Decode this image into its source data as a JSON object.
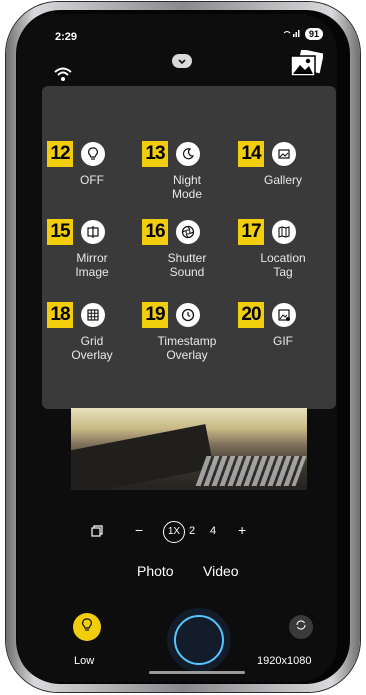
{
  "status": {
    "time": "2:29",
    "battery": "91",
    "signal_icons": "wifi-signal-icons"
  },
  "top": {
    "wifi_icon": "wifi-icon",
    "collapse_icon": "chevron-down-icon",
    "gallery_icon": "gallery-images-icon"
  },
  "panel": {
    "items": [
      {
        "num": "12",
        "icon": "bulb-icon",
        "label": "OFF"
      },
      {
        "num": "13",
        "icon": "moon-icon",
        "label": "Night\nMode"
      },
      {
        "num": "14",
        "icon": "image-icon",
        "label": "Gallery"
      },
      {
        "num": "15",
        "icon": "mirror-icon",
        "label": "Mirror\nImage"
      },
      {
        "num": "16",
        "icon": "shutter-aperture-icon",
        "label": "Shutter\nSound"
      },
      {
        "num": "17",
        "icon": "map-icon",
        "label": "Location\nTag"
      },
      {
        "num": "18",
        "icon": "grid-icon",
        "label": "Grid\nOverlay"
      },
      {
        "num": "19",
        "icon": "clock-icon",
        "label": "Timestamp\nOverlay"
      },
      {
        "num": "20",
        "icon": "gif-image-icon",
        "label": "GIF"
      }
    ]
  },
  "zoom": {
    "minus": "−",
    "selected": "1X",
    "option2": "2",
    "option3": "4",
    "plus": "+"
  },
  "modes": {
    "photo": "Photo",
    "video": "Video"
  },
  "bottom": {
    "flash_label": "Low",
    "resolution_label": "1920x1080"
  },
  "colors": {
    "badge": "#f2cd0c",
    "panel": "#3a3a3a",
    "shutter_ring": "#56c5ff"
  }
}
